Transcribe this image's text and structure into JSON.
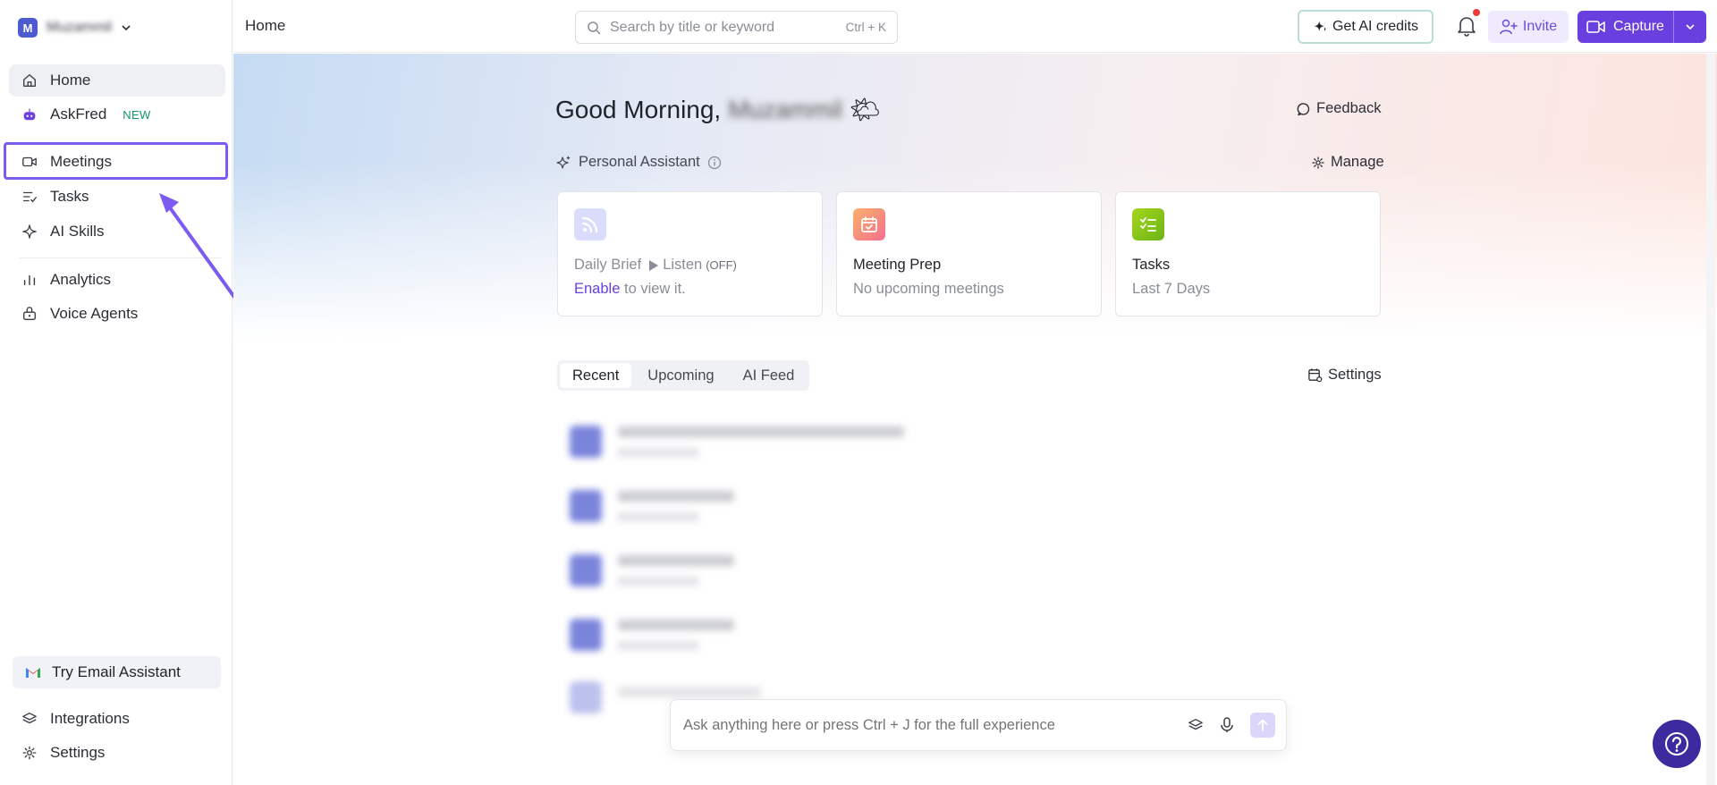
{
  "workspace": {
    "avatar_letter": "M",
    "name": "Muzammil"
  },
  "sidebar": {
    "items": [
      {
        "label": "Home",
        "icon": "home-icon"
      },
      {
        "label": "AskFred",
        "badge": "NEW",
        "icon": "robot-icon"
      },
      {
        "label": "Meetings",
        "icon": "video-icon"
      },
      {
        "label": "Tasks",
        "icon": "tasks-icon"
      },
      {
        "label": "AI Skills",
        "icon": "sparkle-icon"
      },
      {
        "label": "Analytics",
        "icon": "bar-chart-icon"
      },
      {
        "label": "Voice Agents",
        "icon": "voice-agent-icon"
      }
    ],
    "email_assistant": "Try Email Assistant",
    "bottom_items": [
      {
        "label": "Integrations",
        "icon": "layers-icon"
      },
      {
        "label": "Settings",
        "icon": "gear-icon"
      }
    ]
  },
  "header": {
    "breadcrumb": "Home",
    "search_placeholder": "Search by title or keyword",
    "search_shortcut": "Ctrl + K",
    "credits_label": "Get AI credits",
    "invite_label": "Invite",
    "capture_label": "Capture"
  },
  "main": {
    "greeting": "Good Morning,",
    "user_name": "Muzammil",
    "greeting_emoji": "🌤",
    "feedback_label": "Feedback",
    "personal_assistant_label": "Personal Assistant",
    "manage_label": "Manage",
    "cards": [
      {
        "title": "Daily Brief",
        "listen": "Listen",
        "status": "(OFF)",
        "link": "Enable",
        "subtitle": "to view it."
      },
      {
        "title": "Meeting Prep",
        "subtitle": "No upcoming meetings"
      },
      {
        "title": "Tasks",
        "subtitle": "Last 7 Days"
      }
    ],
    "tabs": [
      "Recent",
      "Upcoming",
      "AI Feed"
    ],
    "active_tab": "Recent",
    "settings_label": "Settings",
    "ask_placeholder": "Ask anything here or press Ctrl + J for the full experience"
  },
  "colors": {
    "accent": "#6a3fe0",
    "highlight_box": "#7c5cf0",
    "workspace_avatar": "#4e5bd0",
    "notification_dot": "#ef3b3b",
    "help_button": "#3c2a9e"
  }
}
